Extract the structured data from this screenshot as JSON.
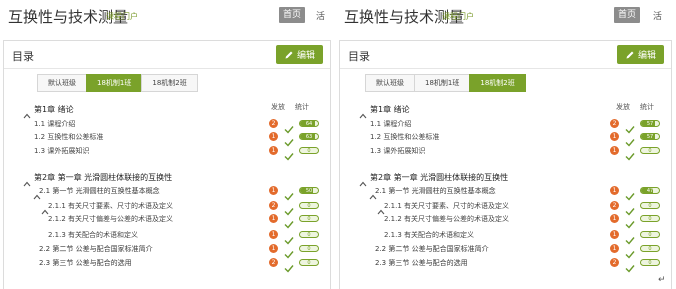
{
  "panes": [
    {
      "id": "left",
      "course_title": "互换性与技术测量",
      "portal_link": "课程门户",
      "home_label": "首页",
      "top_extra": "活",
      "card_title": "目录",
      "edit_label": "编辑",
      "tabs": [
        {
          "label": "默认班级",
          "active": false
        },
        {
          "label": "18机制1班",
          "active": true
        },
        {
          "label": "18机制2班",
          "active": false
        }
      ],
      "columns": {
        "publish": "发放",
        "stats": "统计"
      },
      "rows": [
        {
          "level": "chapter",
          "label": "第1章 绪论",
          "caret": true
        },
        {
          "level": "item",
          "label": "1.1  课程介绍",
          "badge": "2",
          "pill": "64",
          "fill": 0.85
        },
        {
          "level": "item",
          "label": "1.2  互换性和公差标准",
          "badge": "1",
          "pill": "63",
          "fill": 0.85
        },
        {
          "level": "item",
          "label": "1.3  课外拓展知识",
          "badge": "1",
          "pill": "0",
          "fill": 0.0
        },
        {
          "level": "chapter",
          "label": "第2章 第一章 光滑圆柱体联接的互换性",
          "caret": true
        },
        {
          "level": "section",
          "label": "2.1  第一节 光滑圆柱的互换性基本概念",
          "badge": "1",
          "pill": "50",
          "fill": 0.7,
          "caret": true
        },
        {
          "level": "sub",
          "label": "2.1.1  有关尺寸要素、尺寸的术语及定义",
          "badge": "2",
          "pill": "0",
          "fill": 0.0,
          "caret": true
        },
        {
          "level": "sub",
          "label": "2.1.2  有关尺寸偏差与公差的术语及定义",
          "badge": "1",
          "pill": "0",
          "fill": 0.0
        },
        {
          "level": "sub",
          "label": "2.1.3  有关配合的术语和定义",
          "badge": "1",
          "pill": "0",
          "fill": 0.0
        },
        {
          "level": "section",
          "label": "2.2  第二节 公差与配合国家标准简介",
          "badge": "1",
          "pill": "0",
          "fill": 0.0
        },
        {
          "level": "section",
          "label": "2.3  第三节 公差与配合的选用",
          "badge": "2",
          "pill": "0",
          "fill": 0.0
        }
      ]
    },
    {
      "id": "right",
      "course_title": "互换性与技术测量",
      "portal_link": "课程门户",
      "home_label": "首页",
      "top_extra": "活",
      "card_title": "目录",
      "edit_label": "编辑",
      "tabs": [
        {
          "label": "默认班级",
          "active": false
        },
        {
          "label": "18机制1班",
          "active": false
        },
        {
          "label": "18机制2班",
          "active": true
        }
      ],
      "columns": {
        "publish": "发放",
        "stats": "统计"
      },
      "rows": [
        {
          "level": "chapter",
          "label": "第1章 绪论",
          "caret": true
        },
        {
          "level": "item",
          "label": "1.1  课程介绍",
          "badge": "2",
          "pill": "57",
          "fill": 0.8
        },
        {
          "level": "item",
          "label": "1.2  互换性和公差标准",
          "badge": "1",
          "pill": "57",
          "fill": 0.8
        },
        {
          "level": "item",
          "label": "1.3  课外拓展知识",
          "badge": "1",
          "pill": "0",
          "fill": 0.0
        },
        {
          "level": "chapter",
          "label": "第2章 第一章 光滑圆柱体联接的互换性",
          "caret": true
        },
        {
          "level": "section",
          "label": "2.1  第一节 光滑圆柱的互换性基本概念",
          "badge": "1",
          "pill": "47",
          "fill": 0.65,
          "caret": true
        },
        {
          "level": "sub",
          "label": "2.1.1  有关尺寸要素、尺寸的术语及定义",
          "badge": "2",
          "pill": "0",
          "fill": 0.0,
          "caret": true
        },
        {
          "level": "sub",
          "label": "2.1.2  有关尺寸偏差与公差的术语及定义",
          "badge": "1",
          "pill": "0",
          "fill": 0.0
        },
        {
          "level": "sub",
          "label": "2.1.3  有关配合的术语和定义",
          "badge": "1",
          "pill": "0",
          "fill": 0.0
        },
        {
          "level": "section",
          "label": "2.2  第二节 公差与配合国家标准简介",
          "badge": "1",
          "pill": "0",
          "fill": 0.0
        },
        {
          "level": "section",
          "label": "2.3  第三节 公差与配合的选用",
          "badge": "2",
          "pill": "0",
          "fill": 0.0
        }
      ]
    }
  ],
  "return_mark": "↵",
  "colors": {
    "accent": "#7aa22a",
    "badge": "#e36b2c",
    "home_btn": "#8c8c8c"
  }
}
